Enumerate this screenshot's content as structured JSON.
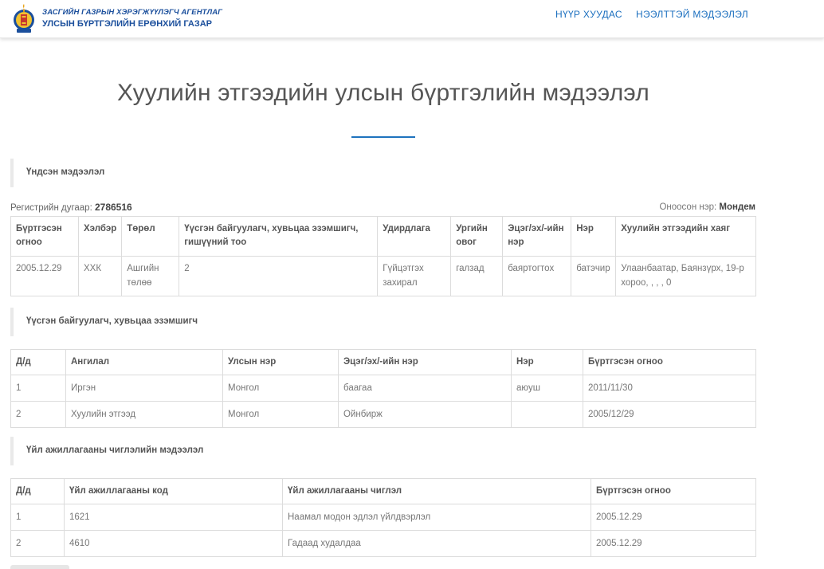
{
  "header": {
    "org_line1": "ЗАСГИЙН ГАЗРЫН ХЭРЭГЖҮҮЛЭГЧ АГЕНТЛАГ",
    "org_line2": "УЛСЫН БҮРТГЭЛИЙН ЕРӨНХИЙ ГАЗАР",
    "nav_home": "НҮҮР ХУУДАС",
    "nav_contact": "НЭЭЛТТЭЙ МЭДЭЭЛЭЛ"
  },
  "title": "Хуулийн этгээдийн улсын бүртгэлийн мэдээлэл",
  "basic": {
    "section_label": "Үндсэн мэдээлэл",
    "reg_label": "Регистрийн дугаар:",
    "reg_value": "2786516",
    "name_label": "Оноосон нэр:",
    "name_value": "Мондем",
    "headers": [
      "Бүртгэсэн огноо",
      "Хэлбэр",
      "Төрөл",
      "Үүсгэн байгуулагч, хувьцаа эзэмшигч, гишүүний тоо",
      "Удирдлага",
      "Ургийн овог",
      "Эцэг/эх/-ийн нэр",
      "Нэр",
      "Хуулийн этгээдийн хаяг"
    ],
    "row": [
      "2005.12.29",
      "ХХК",
      "Ашгийн төлөө",
      "2",
      "Гүйцэтгэх захирал",
      "галзад",
      "баяртогтох",
      "батэчир",
      "Улаанбаатар, Баянзүрх, 19-р хороо, , , , 0"
    ]
  },
  "founders": {
    "section_label": "Үүсгэн байгуулагч, хувьцаа эзэмшигч",
    "headers": [
      "Д/д",
      "Ангилал",
      "Улсын нэр",
      "Эцэг/эх/-ийн нэр",
      "Нэр",
      "Бүртгэсэн огноо"
    ],
    "rows": [
      [
        "1",
        "Иргэн",
        "Монгол",
        "баагаа",
        "аюуш",
        "2011/11/30"
      ],
      [
        "2",
        "Хуулийн этгээд",
        "Монгол",
        "Ойнбирж",
        "",
        "2005/12/29"
      ]
    ]
  },
  "activities": {
    "section_label": "Үйл ажиллагааны чиглэлийн мэдээлэл",
    "headers": [
      "Д/д",
      "Үйл ажиллагааны код",
      "Үйл ажиллагааны чиглэл",
      "Бүртгэсэн огноо"
    ],
    "rows": [
      [
        "1",
        "1621",
        "Наамал модон эдлэл үйлдвэрлэл",
        "2005.12.29"
      ],
      [
        "2",
        "4610",
        "Гадаад худалдаа",
        "2005.12.29"
      ]
    ]
  }
}
